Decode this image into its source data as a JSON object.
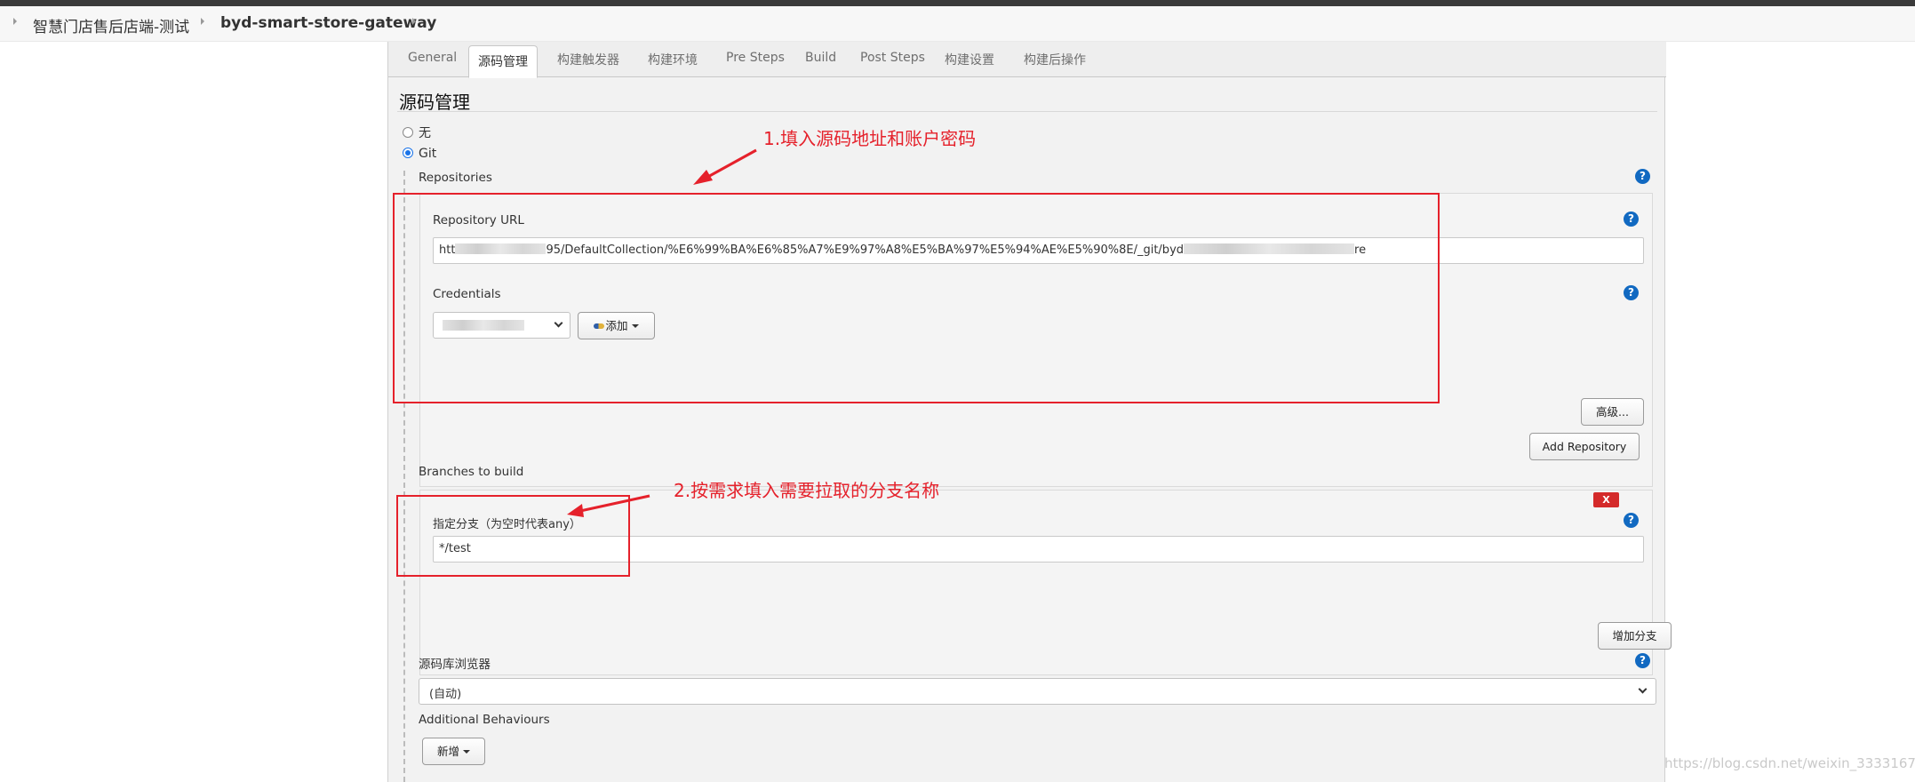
{
  "breadcrumb": {
    "project": "智慧门店售后店端-测试",
    "job": "byd-smart-store-gateway"
  },
  "tabs": [
    "General",
    "源码管理",
    "构建触发器",
    "构建环境",
    "Pre Steps",
    "Build",
    "Post Steps",
    "构建设置",
    "构建后操作"
  ],
  "section_title": "源码管理",
  "scm_options": {
    "none_label": "无",
    "git_label": "Git"
  },
  "repositories": {
    "label": "Repositories",
    "url_label": "Repository URL",
    "url_prefix": "htt",
    "url_middle": "95/DefaultCollection/%E6%99%BA%E6%85%A7%E9%97%A8%E5%BA%97%E5%94%AE%E5%90%8E/_git/byd",
    "url_suffix": "re",
    "credentials_label": "Credentials",
    "add_button": "添加",
    "advanced_button": "高级...",
    "add_repository_button": "Add Repository"
  },
  "branches": {
    "label": "Branches to build",
    "specifier_label": "指定分支（为空时代表any）",
    "specifier_value": "*/test",
    "delete_button": "X",
    "add_branch_button": "增加分支"
  },
  "browser": {
    "label": "源码库浏览器",
    "value": "(自动)"
  },
  "behaviours": {
    "label": "Additional Behaviours",
    "add_button": "新增"
  },
  "help_glyph": "?",
  "annotations": {
    "step1": "1.填入源码地址和账户密码",
    "step2": "2.按需求填入需要拉取的分支名称",
    "color": "#e5212b"
  },
  "watermark": "https://blog.csdn.net/weixin_33331676",
  "colors": {
    "help": "#1169c1",
    "radio_selected": "#1a73e8",
    "delete": "#d42a2a"
  }
}
